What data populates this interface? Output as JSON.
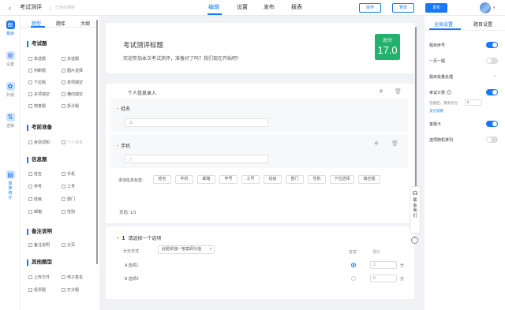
{
  "header": {
    "back": "‹",
    "title": "考试测评",
    "saved": "已自动保存",
    "tabs": [
      "编辑",
      "设置",
      "发布",
      "报表"
    ],
    "buttons": {
      "collab": "协作",
      "preview": "预览",
      "publish": "发布"
    }
  },
  "rail": [
    {
      "label": "题目",
      "glyph": "⊞"
    },
    {
      "label": "设置",
      "glyph": "⚙"
    },
    {
      "label": "外观",
      "glyph": "✿"
    },
    {
      "label": "逻辑",
      "glyph": "⇅"
    },
    {
      "label": "",
      "glyph": "▤",
      "vertical": "题库统计"
    }
  ],
  "library": {
    "tabs": [
      "题型",
      "题库",
      "大纲"
    ],
    "sections": {
      "exam": "考试题",
      "pre": "考前准备",
      "info": "信息题",
      "note": "备注说明",
      "other": "其他题型"
    },
    "exam_items": [
      "单选题",
      "多选题",
      "判断题",
      "图片选择",
      "下拉题",
      "单项填空",
      "多项填空",
      "横向填空",
      "简答题",
      "拆分题"
    ],
    "pre_items": [
      "考前须知",
      "个人信息"
    ],
    "info_items": [
      "姓名",
      "手机",
      "学号",
      "工号",
      "班级",
      "部门",
      "邮箱",
      "性别"
    ],
    "note_items": [
      "备注说明",
      "分页"
    ],
    "other_items": [
      "上传文件",
      "电子签名",
      "投票题",
      "打分题"
    ]
  },
  "canvas": {
    "title": "考试测评标题",
    "desc": "欢迎参加本次考试测评，准备好了吗？我们现在开始吧！",
    "score_label": "总分",
    "score_value": "17.0",
    "personal_section": "个人信息录入",
    "field1": "姓名",
    "field2": "手机",
    "add_label": "添加信息标签:",
    "chips": [
      "姓名",
      "手机",
      "邮箱",
      "学号",
      "工号",
      "班级",
      "部门",
      "性别",
      "下拉选择",
      "填空题"
    ],
    "pager": "页码: 1/1",
    "q1_num": "1",
    "q1_title": "请选择一个选项",
    "calc_label": "计分方式",
    "calc_value": "此题单独一答案即分值",
    "col_answer": "答案",
    "col_score": "得分",
    "options": [
      "A 选项1",
      "B 选项2"
    ],
    "scores": [
      "2",
      "0"
    ],
    "unit": "分"
  },
  "float": {
    "vertical": "联系我们"
  },
  "settings": {
    "tabs": [
      "全局设置",
      "题目设置"
    ],
    "rows": [
      {
        "label": "题目序号",
        "on": true
      },
      {
        "label": "一页一题",
        "on": false
      },
      {
        "label": "题目批量处理",
        "caret": true
      },
      {
        "label": "考试计费",
        "on": true,
        "help": "?"
      },
      {
        "label": "答题卡",
        "on": true
      },
      {
        "label": "选项随机排列",
        "on": false
      }
    ],
    "sub_text": "答题后，需要支付",
    "sub_value": "0",
    "sub_link": "支付说明"
  }
}
